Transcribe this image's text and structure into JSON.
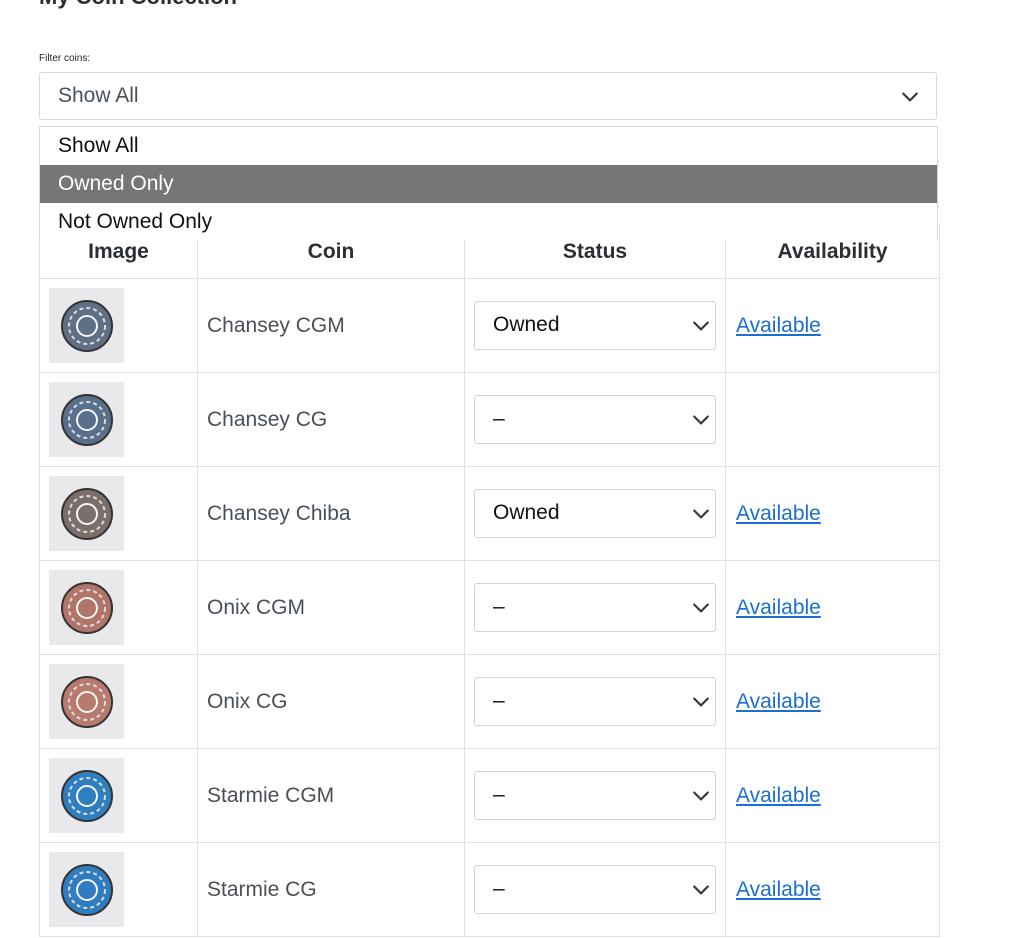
{
  "page": {
    "title": "My Coin Collection"
  },
  "filter": {
    "label": "Filter coins:",
    "value": "Show All",
    "options": [
      "Show All",
      "Owned Only",
      "Not Owned Only"
    ],
    "highlighted": "Owned Only"
  },
  "table": {
    "headers": [
      "Image",
      "Coin",
      "Status",
      "Availability"
    ],
    "rows": [
      {
        "coin": "Chansey CGM",
        "status": "Owned",
        "availability": "Available",
        "coin_color": "#5f6f86"
      },
      {
        "coin": "Chansey CG",
        "status": "–",
        "availability": "",
        "coin_color": "#58708c"
      },
      {
        "coin": "Chansey Chiba",
        "status": "Owned",
        "availability": "Available",
        "coin_color": "#7a6f6a"
      },
      {
        "coin": "Onix CGM",
        "status": "–",
        "availability": "Available",
        "coin_color": "#b07468"
      },
      {
        "coin": "Onix CG",
        "status": "–",
        "availability": "Available",
        "coin_color": "#b77a6c"
      },
      {
        "coin": "Starmie CGM",
        "status": "–",
        "availability": "Available",
        "coin_color": "#2f7fc0"
      },
      {
        "coin": "Starmie CG",
        "status": "–",
        "availability": "Available",
        "coin_color": "#2f7cc0"
      }
    ]
  },
  "icons": {
    "select_arrow": "chevron-down-icon",
    "coin_image": "coin-icon"
  },
  "colors": {
    "link": "#1a6fd0",
    "option_highlight": "#767676"
  }
}
